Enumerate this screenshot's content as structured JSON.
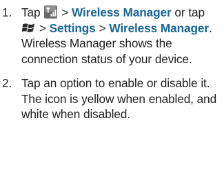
{
  "colors": {
    "ui_term": "#1a6696",
    "body_text": "#222222",
    "signal_icon_bg": "#6b6b6b"
  },
  "icons": {
    "signal": "signal-bars-icon",
    "start": "windows-flag-icon"
  },
  "steps": [
    {
      "number": "1.",
      "tap_1": "Tap",
      "sep_1": ">",
      "term_1": "Wireless Manager",
      "or_tap": "or tap",
      "sep_2": ">",
      "term_2": "Settings",
      "sep_3": ">",
      "term_3": "Wireless Manager",
      "tail": ". Wireless Manager shows the connection status of your device."
    },
    {
      "number": "2.",
      "text": "Tap an option to enable or disable it. The icon is yellow when enabled, and white when disabled."
    }
  ]
}
